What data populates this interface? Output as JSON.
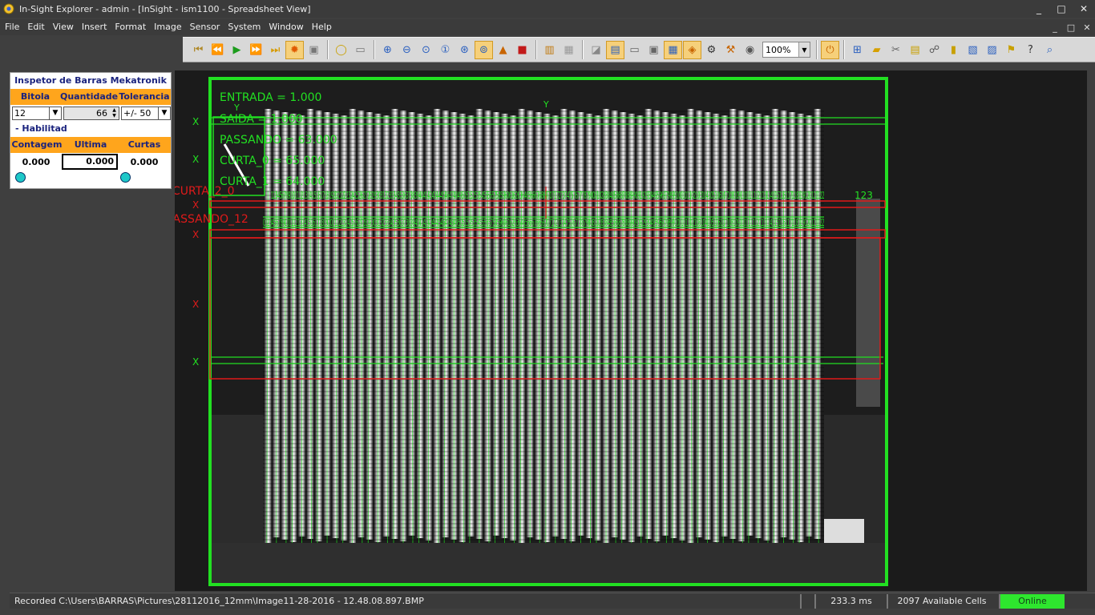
{
  "window": {
    "title": "In-Sight Explorer - admin - [InSight - ism1100 - Spreadsheet View]",
    "controls": [
      "_",
      "□",
      "✕"
    ]
  },
  "menu": {
    "items": [
      "File",
      "Edit",
      "View",
      "Insert",
      "Format",
      "Image",
      "Sensor",
      "System",
      "Window",
      "Help"
    ],
    "mdi_controls": [
      "_",
      "□",
      "✕"
    ]
  },
  "toolbar": {
    "zoom_value": "100%",
    "icons": [
      "first-icon",
      "rewind-icon",
      "play-icon",
      "fast-forward-icon",
      "last-icon",
      "live-video-icon",
      "record-icon",
      "circle-icon",
      "camera-icon",
      "zoom-in-icon",
      "zoom-out-icon",
      "zoom-fit-icon",
      "zoom-1-icon",
      "zoom-window-icon",
      "zoom-fill-icon",
      "image-icon",
      "color-image-icon",
      "stack-icon",
      "grid-icon",
      "graphics-icon",
      "spreadsheet-icon",
      "custom-view-icon",
      "window-icon",
      "table-icon",
      "overlay-icon",
      "sensor-icon",
      "settings-icon",
      "calibrate-icon"
    ]
  },
  "panel": {
    "title": "Inspetor de Barras Mekatronik",
    "headers": [
      "Bitola",
      "Quantidade",
      "Tolerancia"
    ],
    "bitola": "12",
    "quantidade": "66",
    "tolerancia": "+/- 50",
    "habilitado": "- Habilitad",
    "result_headers": [
      "Contagem",
      "Ultima",
      "Curtas"
    ],
    "contagem": "0.000",
    "ultima": "0.000",
    "curtas": "0.000"
  },
  "overlay": {
    "results": [
      "ENTRADA = 1.000",
      "SAIDA = 1.000",
      "PASSANDO = 63.000",
      "CURTA_0 = 65.000",
      "CURTA_1 = 64.000"
    ],
    "red_label_1": "CURTA_2_0",
    "red_label_2": "PASSANDO_12",
    "edge_count": "123",
    "axis_x": "X",
    "axis_y": "Y"
  },
  "status": {
    "recorded": "Recorded C:\\Users\\BARRAS\\Pictures\\28112016_12mm\\Image11-28-2016 - 12.48.08.897.BMP",
    "time": "233.3 ms",
    "cells": "2097 Available Cells",
    "online": "Online"
  },
  "colors": {
    "bg": "#3f3f3f",
    "orange": "#ffa51c",
    "navy": "#1a237e",
    "overlay_green": "#22e022",
    "overlay_red": "#e01a1a",
    "online": "#2ee62e"
  }
}
